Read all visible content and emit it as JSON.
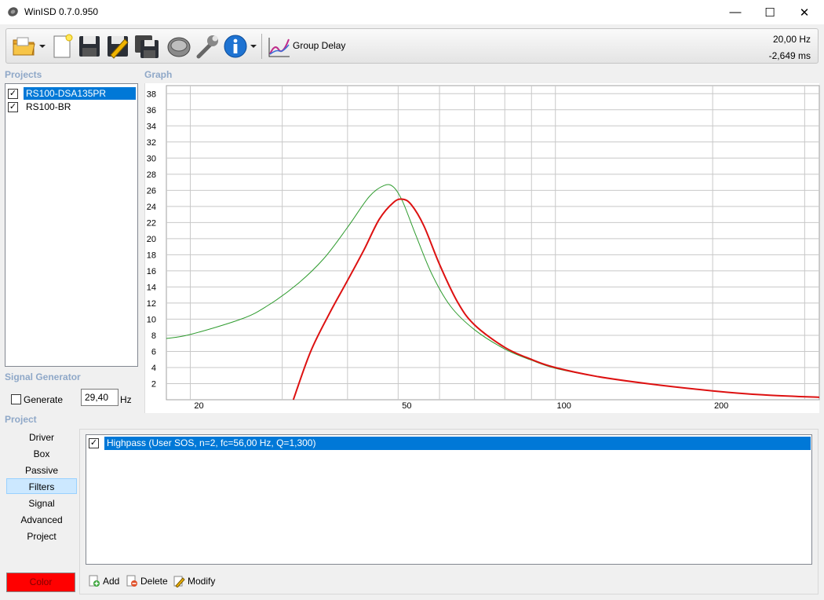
{
  "window": {
    "title": "WinISD 0.7.0.950",
    "controls": {
      "minimize": "—",
      "maximize": "☐",
      "close": "✕"
    }
  },
  "toolbar": {
    "items": [
      "open-folder-icon",
      "dropdown-arrow-icon",
      "new-document-icon",
      "save-icon",
      "edit-icon",
      "save-all-icon",
      "driver-icon",
      "wrench-icon",
      "info-icon",
      "dropdown-arrow-icon",
      "group-delay-chart-icon"
    ],
    "graph_type_label": "Group Delay",
    "readout_frequency": "20,00 Hz",
    "readout_value": "-2,649 ms"
  },
  "projects": {
    "header": "Projects",
    "items": [
      {
        "label": "RS100-DSA135PR",
        "checked": true,
        "selected": true
      },
      {
        "label": "RS100-BR",
        "checked": true,
        "selected": false
      }
    ]
  },
  "signal_generator": {
    "header": "Signal Generator",
    "generate_label": "Generate",
    "generate_checked": false,
    "frequency_value": "29,40",
    "unit": "Hz"
  },
  "project_menu": {
    "header": "Project",
    "items": [
      "Driver",
      "Box",
      "Passive Radiator",
      "Filters",
      "Signal",
      "Advanced",
      "Project"
    ],
    "active": "Filters",
    "color_button": "Color"
  },
  "graph": {
    "header": "Graph"
  },
  "chart_data": {
    "type": "line",
    "x_scale": "log",
    "xlim": [
      18,
      320
    ],
    "ylim": [
      0,
      39
    ],
    "x_ticks": [
      20,
      50,
      100,
      200
    ],
    "x_tick_labels": [
      "20",
      "50",
      "100",
      "200"
    ],
    "y_ticks": [
      2,
      4,
      6,
      8,
      10,
      12,
      14,
      16,
      18,
      20,
      22,
      24,
      26,
      28,
      30,
      32,
      34,
      36,
      38
    ],
    "y_tick_labels": [
      "2",
      "4",
      "6",
      "8",
      "10",
      "12",
      "14",
      "16",
      "18",
      "20",
      "22",
      "24",
      "26",
      "28",
      "30",
      "32",
      "34",
      "36",
      "38"
    ],
    "grid": true,
    "series": [
      {
        "color": "#2e9b2e",
        "x": [
          18,
          20,
          25,
          28,
          32,
          36,
          40,
          44,
          47,
          49,
          51,
          54,
          58,
          63,
          70,
          80,
          90,
          100,
          120,
          150,
          200,
          250,
          320
        ],
        "y": [
          7.6,
          8.1,
          10.0,
          11.6,
          14.3,
          17.5,
          21.4,
          25.2,
          26.6,
          26.4,
          24.6,
          20.5,
          15.6,
          11.6,
          8.7,
          6.3,
          4.9,
          3.9,
          2.9,
          2.0,
          1.1,
          0.6,
          0.3
        ]
      },
      {
        "color": "#dd1111",
        "x": [
          31.5,
          34,
          37,
          40,
          43,
          46,
          49,
          51,
          53,
          56,
          60,
          65,
          70,
          80,
          90,
          100,
          120,
          150,
          200,
          250,
          320
        ],
        "y": [
          0,
          6.0,
          10.8,
          14.8,
          18.6,
          22.4,
          24.5,
          24.9,
          24.2,
          21.6,
          16.8,
          12.1,
          9.3,
          6.5,
          5.0,
          4.0,
          2.9,
          2.0,
          1.1,
          0.6,
          0.3
        ]
      }
    ]
  },
  "filters": {
    "items": [
      {
        "label": "Highpass (User SOS, n=2, fc=56,00 Hz, Q=1,300)",
        "checked": true,
        "selected": true
      }
    ],
    "add_label": "Add",
    "delete_label": "Delete",
    "modify_label": "Modify"
  }
}
